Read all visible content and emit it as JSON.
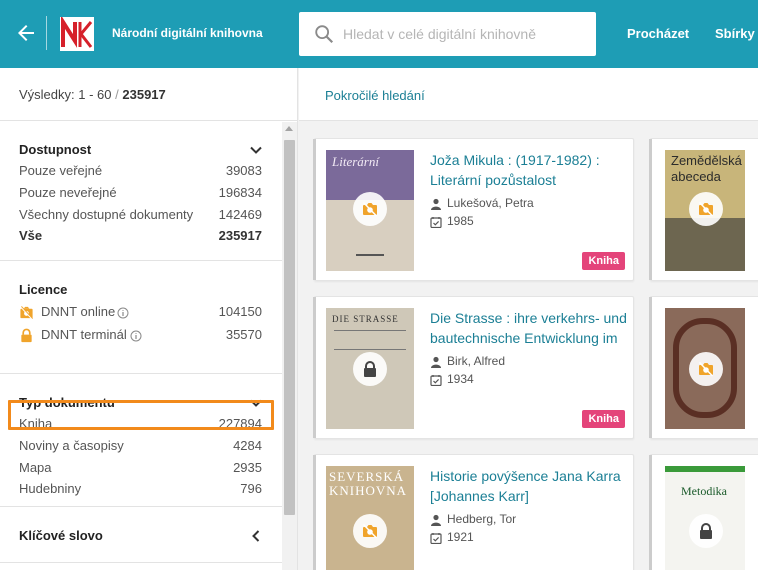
{
  "header": {
    "logo_letters": "NK",
    "title": "Národní digitální knihovna",
    "search_placeholder": "Hledat v celé digitální knihovně",
    "nav": [
      "Procházet",
      "Sbírky"
    ]
  },
  "results": {
    "label": "Výsledky: 1 - 60",
    "separator": "/",
    "total": "235917"
  },
  "advanced_search": "Pokročilé hledání",
  "facets": {
    "availability": {
      "title": "Dostupnost",
      "items": [
        {
          "label": "Pouze veřejné",
          "count": "39083"
        },
        {
          "label": "Pouze neveřejné",
          "count": "196834"
        },
        {
          "label": "Všechny dostupné dokumenty",
          "count": "142469"
        },
        {
          "label": "Vše",
          "count": "235917"
        }
      ]
    },
    "license": {
      "title": "Licence",
      "items": [
        {
          "label": "DNNT online",
          "count": "104150",
          "icon": "dnnt-online-icon"
        },
        {
          "label": "DNNT terminál",
          "count": "35570",
          "icon": "lock-icon"
        }
      ]
    },
    "doc_type": {
      "title": "Typ dokumentu",
      "items": [
        {
          "label": "Kniha",
          "count": "227894"
        },
        {
          "label": "Noviny a časopisy",
          "count": "4284"
        },
        {
          "label": "Mapa",
          "count": "2935"
        },
        {
          "label": "Hudebniny",
          "count": "796"
        }
      ]
    },
    "keyword": {
      "title": "Klíčové slovo"
    }
  },
  "cards": [
    {
      "title": "Joža Mikula : (1917-1982) : Literární pozůstalost",
      "author": "Lukešová, Petra",
      "year": "1985",
      "badge": "Kniha",
      "thumb_text": "Literární",
      "access": "dnnt-online-icon"
    },
    {
      "title": "Die Strasse : ihre verkehrs- und bautechnische Entwicklung im",
      "author": "Birk, Alfred",
      "year": "1934",
      "badge": "Kniha",
      "thumb_text": "DIE STRASSE",
      "access": "lock-icon"
    },
    {
      "title": "Historie povýšence Jana Karra [Johannes Karr]",
      "author": "Hedberg, Tor",
      "year": "1921",
      "badge": "",
      "thumb_text": "SEVERSKÁ KNIHOVNA",
      "access": "dnnt-online-icon"
    },
    {
      "title": "",
      "author": "",
      "year": "",
      "badge": "",
      "thumb_text": "Zemědělská abeceda",
      "access": "dnnt-online-icon"
    },
    {
      "title": "",
      "author": "",
      "year": "",
      "badge": "",
      "thumb_text": "",
      "access": "dnnt-online-icon"
    },
    {
      "title": "",
      "author": "",
      "year": "",
      "badge": "",
      "thumb_text": "Metodika",
      "access": "lock-icon"
    }
  ]
}
